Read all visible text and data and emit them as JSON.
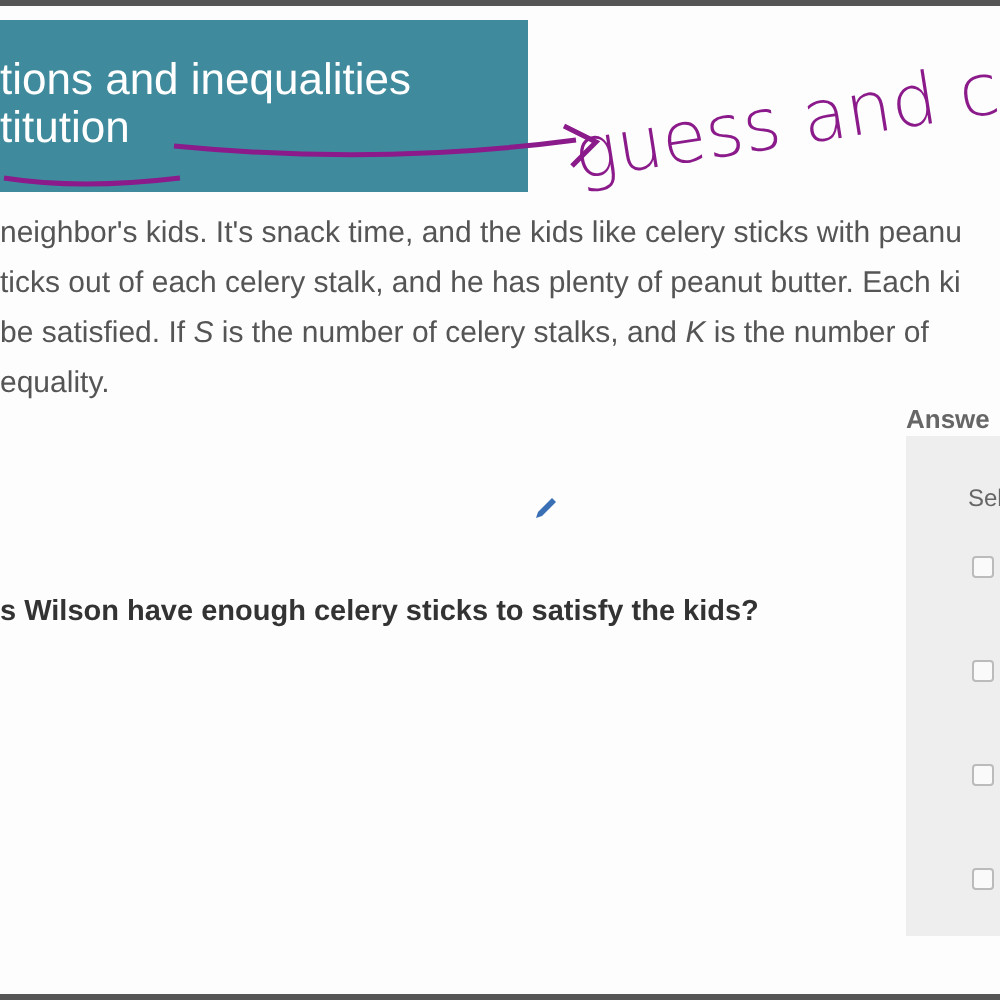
{
  "banner": {
    "lines": [
      "tions and inequalities",
      "titution"
    ]
  },
  "annotation": {
    "text": "guess and c"
  },
  "problem": {
    "lines": [
      "neighbor's kids. It's snack time, and the kids like celery sticks with peanu",
      "ticks out of each celery stalk, and he has plenty of peanut butter. Each ki",
      "be satisfied. If *S* is the number of celery stalks, and *K* is the number of",
      "equality."
    ]
  },
  "question": "s Wilson have enough celery sticks to satisfy the kids?",
  "answer_panel": {
    "title": "Answe",
    "prompt": "Sel",
    "choices": [
      {
        "checked": false
      },
      {
        "checked": false
      },
      {
        "checked": false
      },
      {
        "checked": false
      }
    ]
  }
}
